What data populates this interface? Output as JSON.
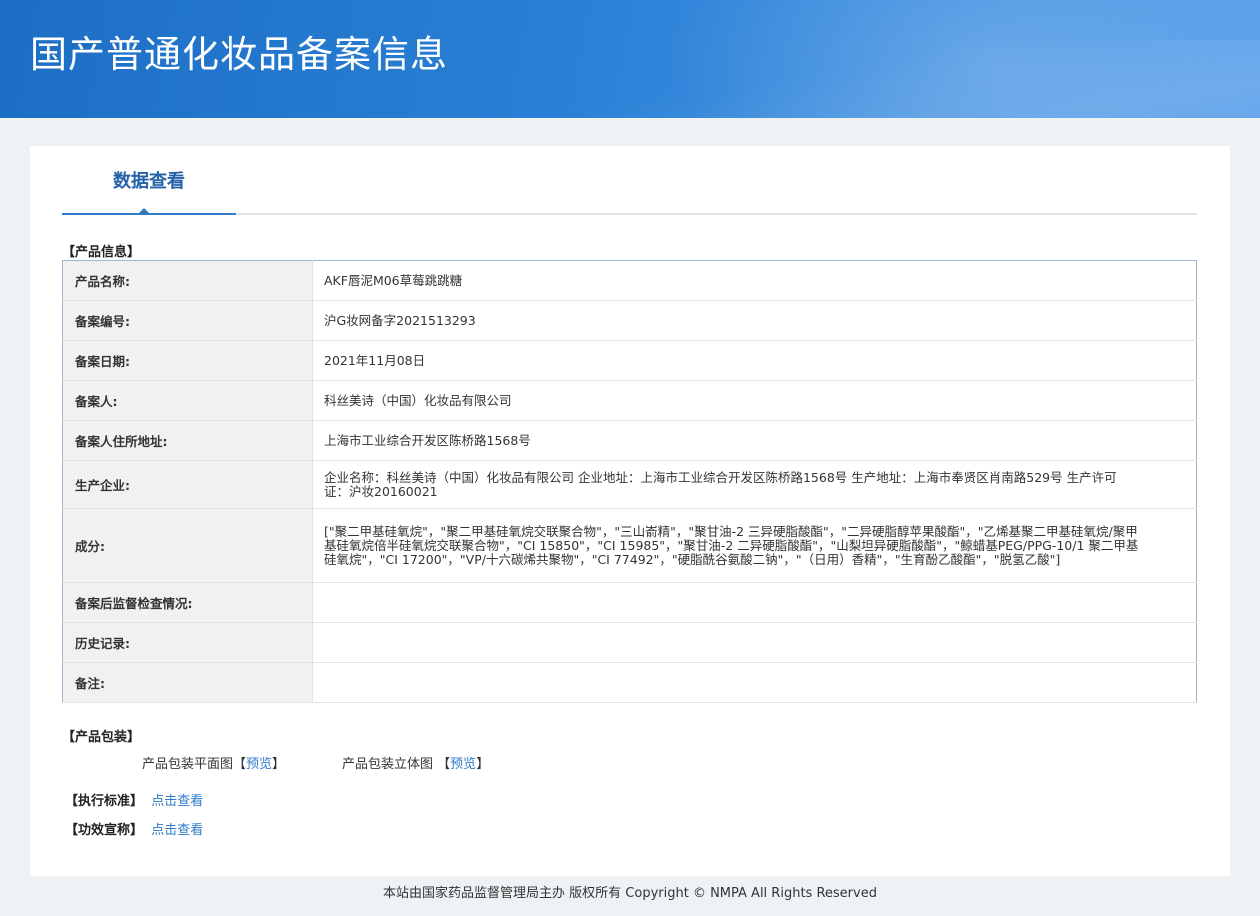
{
  "header": {
    "title": "国产普通化妆品备案信息"
  },
  "tabs": [
    {
      "label": "数据查看",
      "active": true
    }
  ],
  "product_info": {
    "section_label": "【产品信息】",
    "rows": [
      {
        "label": "产品名称:",
        "value": "AKF唇泥M06草莓跳跳糖"
      },
      {
        "label": "备案编号:",
        "value": "沪G妆网备字2021513293"
      },
      {
        "label": "备案日期:",
        "value": "2021年11月08日"
      },
      {
        "label": "备案人:",
        "value": "科丝美诗（中国）化妆品有限公司"
      },
      {
        "label": "备案人住所地址:",
        "value": "上海市工业综合开发区陈桥路1568号"
      },
      {
        "label": "生产企业:",
        "value": "企业名称：科丝美诗（中国）化妆品有限公司 企业地址：上海市工业综合开发区陈桥路1568号 生产地址：上海市奉贤区肖南路529号 生产许可证：沪妆20160021"
      },
      {
        "label": "成分:",
        "value": "[\"聚二甲基硅氧烷\"，\"聚二甲基硅氧烷交联聚合物\"，\"三山嵛精\"，\"聚甘油-2 三异硬脂酸酯\"，\"二异硬脂醇苹果酸酯\"，\"乙烯基聚二甲基硅氧烷/聚甲基硅氧烷倍半硅氧烷交联聚合物\"，\"CI 15850\"，\"CI 15985\"，\"聚甘油-2 二异硬脂酸酯\"，\"山梨坦异硬脂酸酯\"，\"鲸蜡基PEG/PPG-10/1 聚二甲基硅氧烷\"，\"CI 17200\"，\"VP/十六碳烯共聚物\"，\"CI 77492\"，\"硬脂酰谷氨酸二钠\"，\"（日用）香精\"，\"生育酚乙酸酯\"，\"脱氢乙酸\"]"
      },
      {
        "label": "备案后监督检查情况:",
        "value": ""
      },
      {
        "label": "历史记录:",
        "value": ""
      },
      {
        "label": "备注:",
        "value": ""
      }
    ]
  },
  "packaging": {
    "section_label": "【产品包装】",
    "flat_label": "产品包装平面图",
    "stereo_label": "产品包装立体图",
    "preview_link": "预览",
    "bracket_open": "【",
    "bracket_close": "】"
  },
  "standard": {
    "label": "【执行标准】",
    "link": "点击查看"
  },
  "efficacy": {
    "label": "【功效宣称】",
    "link": "点击查看"
  },
  "footer": {
    "text": "本站由国家药品监督管理局主办 版权所有 Copyright © NMPA All Rights Reserved"
  }
}
